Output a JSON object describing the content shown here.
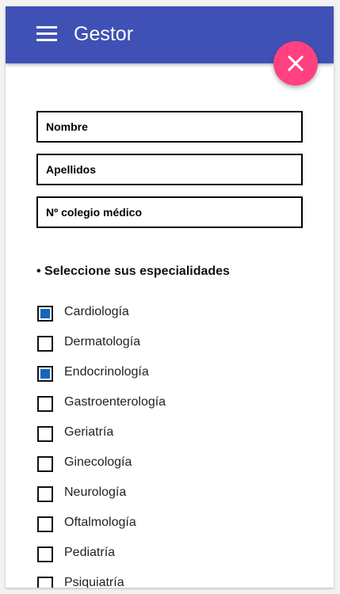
{
  "appbar": {
    "title": "Gestor",
    "menu_icon": "hamburger-menu-icon",
    "color": "#3f51b5"
  },
  "fab": {
    "icon": "close-icon",
    "color": "#ff4081"
  },
  "form": {
    "nombre_placeholder": "Nombre",
    "apellidos_placeholder": "Apellidos",
    "colegio_placeholder": "Nº colegio médico"
  },
  "especialidades": {
    "heading": "• Seleccione sus especialidades",
    "items": [
      {
        "label": "Cardiología",
        "checked": true
      },
      {
        "label": "Dermatología",
        "checked": false
      },
      {
        "label": "Endocrinología",
        "checked": true
      },
      {
        "label": "Gastroenterología",
        "checked": false
      },
      {
        "label": "Geriatría",
        "checked": false
      },
      {
        "label": "Ginecología",
        "checked": false
      },
      {
        "label": "Neurología",
        "checked": false
      },
      {
        "label": "Oftalmología",
        "checked": false
      },
      {
        "label": "Pediatría",
        "checked": false
      },
      {
        "label": "Psiquiatría",
        "checked": false
      }
    ],
    "check_color": "#1565c0"
  }
}
